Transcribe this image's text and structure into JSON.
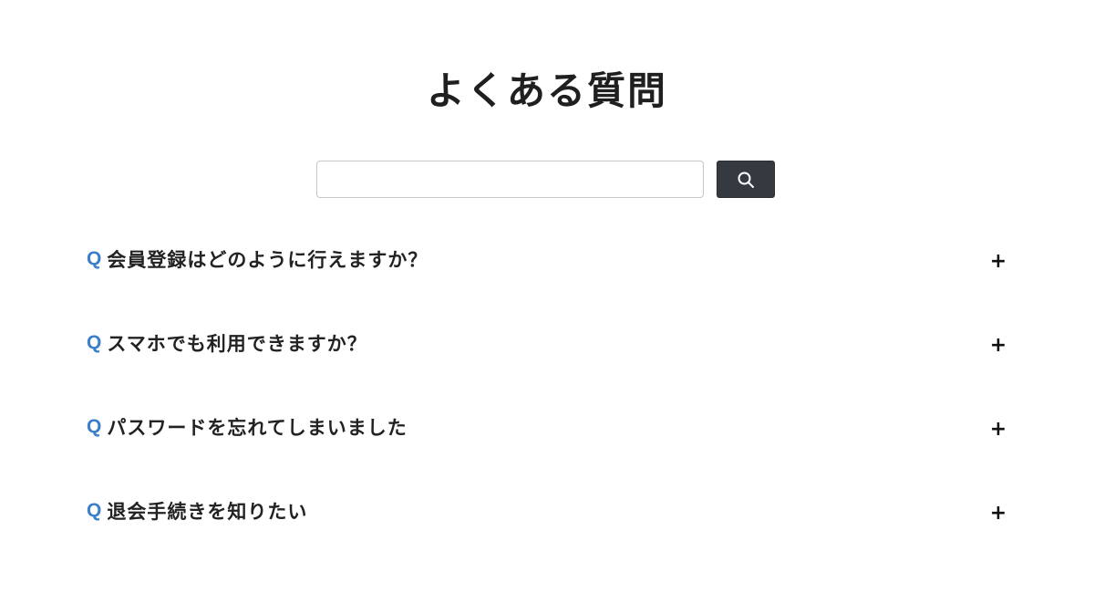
{
  "page": {
    "title": "よくある質問"
  },
  "search": {
    "value": "",
    "placeholder": "",
    "button_icon": "search-icon"
  },
  "faq": {
    "q_marker": "Q",
    "toggle_symbol": "+",
    "items": [
      {
        "question": "会員登録はどのように行えますか？",
        "expanded": false
      },
      {
        "question": "スマホでも利用できますか？",
        "expanded": false
      },
      {
        "question": "パスワードを忘れてしまいました",
        "expanded": false
      },
      {
        "question": "退会手続きを知りたい",
        "expanded": false
      }
    ]
  },
  "colors": {
    "accent_q": "#3a7fc8",
    "button_bg": "#343a40",
    "text": "#222222"
  }
}
